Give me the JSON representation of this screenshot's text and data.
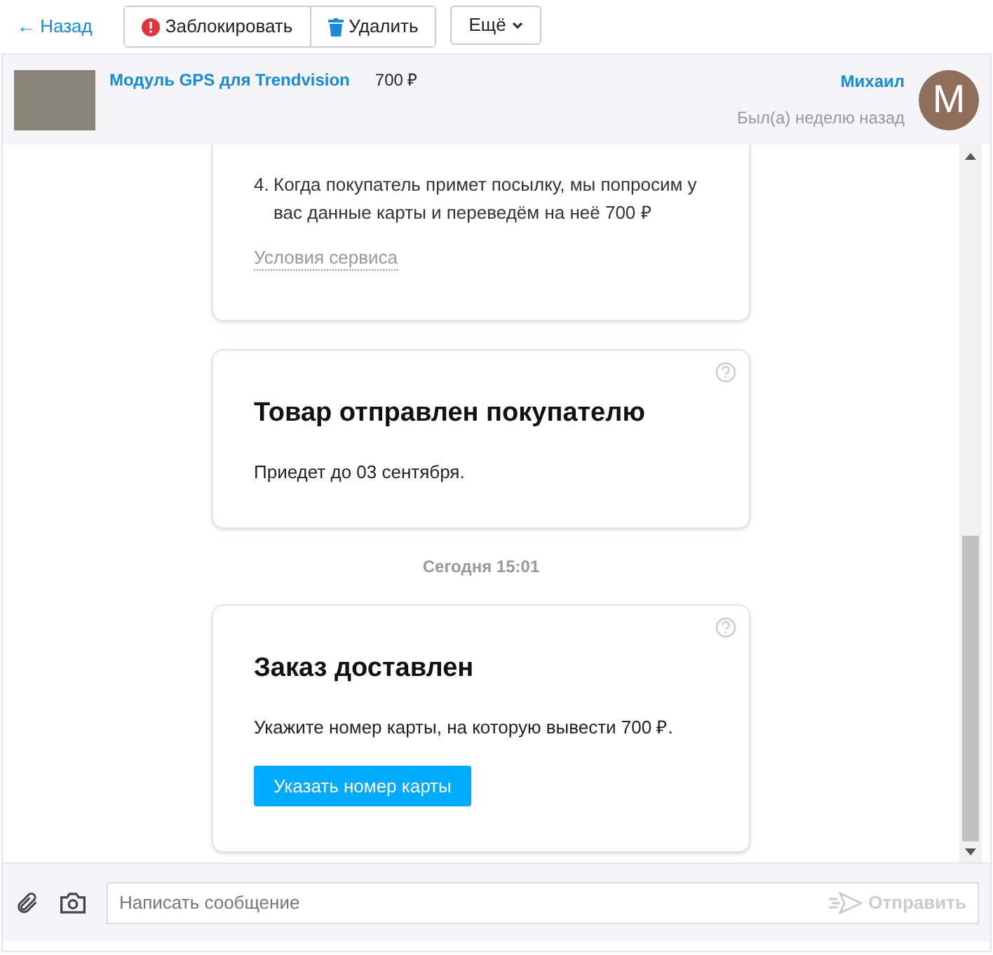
{
  "toolbar": {
    "back": "← Назад",
    "buttons": [
      {
        "label": "Заблокировать",
        "kind": "block"
      },
      {
        "label": "Удалить",
        "kind": "delete"
      },
      {
        "label": "Ещё",
        "kind": "more"
      }
    ]
  },
  "header": {
    "product": "Модуль GPS для Trendvision",
    "price": "700 ₽",
    "user": "Михаил",
    "last_seen": "Был(а) неделю назад",
    "avatar_letter": "M"
  },
  "messages": [
    {
      "kind": "steps",
      "steps": [
        {
          "number": "4.",
          "text": "Когда покупатель примет посылку, мы попросим у вас данные карты и переведём на неё 700 ₽"
        }
      ],
      "link": "Условия сервиса"
    },
    {
      "kind": "card",
      "title": "Товар отправлен покупателю",
      "text": "Приедет до 03 сентября."
    },
    {
      "kind": "date",
      "text": "Сегодня 15:01"
    },
    {
      "kind": "card",
      "title": "Заказ доставлен",
      "text": "Укажите номер карты, на которую вывести 700 ₽.",
      "button": "Указать номер карты"
    }
  ],
  "composer": {
    "placeholder": "Написать сообщение",
    "send": "Отправить"
  }
}
